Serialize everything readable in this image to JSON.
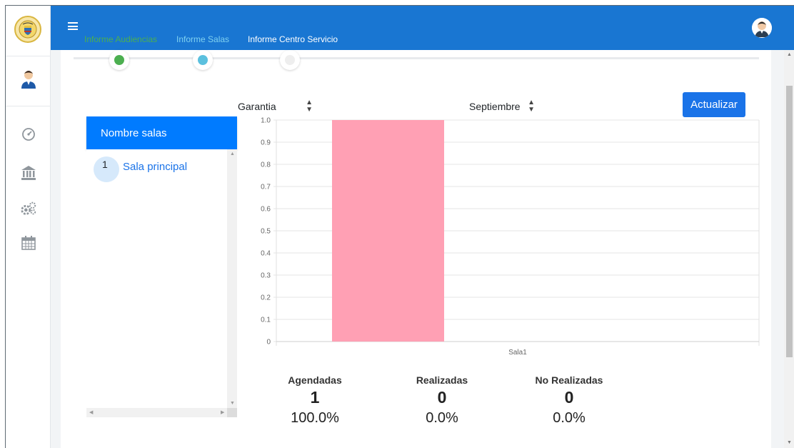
{
  "header": {
    "tabs": [
      {
        "label": "Informe Audiencias",
        "color": "#4caf50"
      },
      {
        "label": "Informe Salas",
        "color": "#7fd1f0"
      },
      {
        "label": "Informe Centro Servicio",
        "color": "#ffffff"
      }
    ]
  },
  "sidebar": {
    "icons": [
      "coat-of-arms-logo",
      "user-avatar-icon",
      "dashboard-gauge-icon",
      "bank-building-icon",
      "gears-icon",
      "calendar-icon"
    ]
  },
  "stepper": {
    "colors": [
      "#4caf50",
      "#5bc0de",
      "#eeeeee"
    ]
  },
  "filters": {
    "type_select": "Garantia",
    "month_select": "Septiembre",
    "update_button": "Actualizar"
  },
  "rooms": {
    "header": "Nombre salas",
    "items": [
      {
        "number": "1",
        "name": "Sala principal"
      }
    ]
  },
  "chart_data": {
    "type": "bar",
    "categories": [
      "Sala1"
    ],
    "values": [
      1.0
    ],
    "bar_color": "#ffa0b4",
    "ylim": [
      0,
      1.0
    ],
    "yticks": [
      "0",
      "0.1",
      "0.2",
      "0.3",
      "0.4",
      "0.5",
      "0.6",
      "0.7",
      "0.8",
      "0.9",
      "1.0"
    ],
    "grid": true,
    "title": "",
    "xlabel": "",
    "ylabel": ""
  },
  "summary": [
    {
      "label": "Agendadas",
      "value": "1",
      "percent": "100.0%"
    },
    {
      "label": "Realizadas",
      "value": "0",
      "percent": "0.0%"
    },
    {
      "label": "No Realizadas",
      "value": "0",
      "percent": "0.0%"
    }
  ]
}
